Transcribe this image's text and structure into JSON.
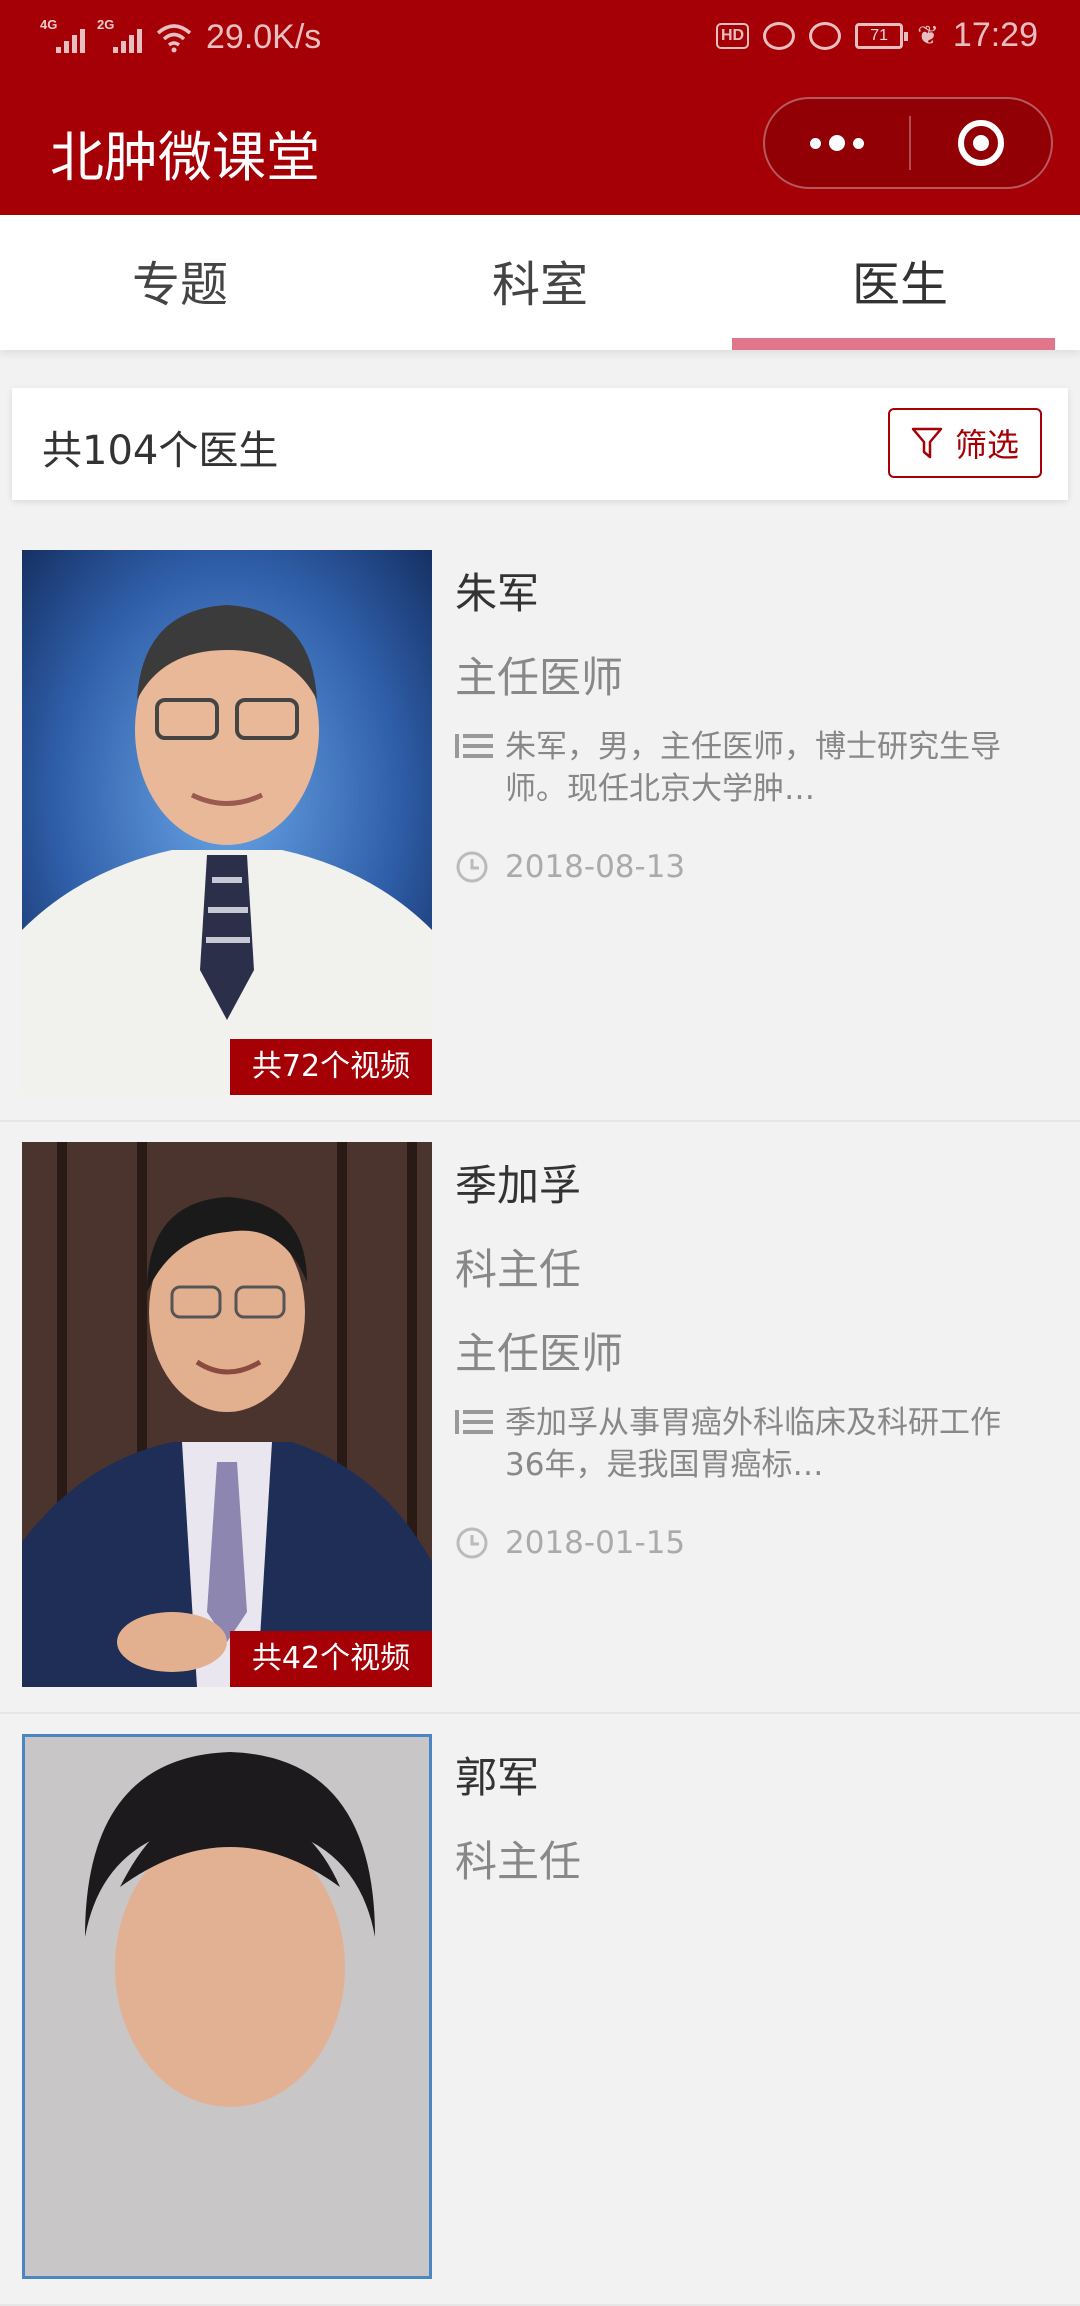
{
  "status_bar": {
    "network_1": "4G",
    "network_2": "2G",
    "speed": "29.0K/s",
    "hd": "HD",
    "battery": "71",
    "time": "17:29"
  },
  "nav": {
    "title": "北肿微课堂"
  },
  "tabs": [
    {
      "label": "专题",
      "active": false
    },
    {
      "label": "科室",
      "active": false
    },
    {
      "label": "医生",
      "active": true
    }
  ],
  "colors": {
    "brand": "#a50006",
    "tab_indicator": "#e0758c"
  },
  "summary": {
    "count_text": "共104个医生",
    "filter_label": "筛选"
  },
  "doctors": [
    {
      "name": "朱军",
      "roles": [
        "主任医师"
      ],
      "description": "朱军，男，主任医师，博士研究生导师。现任北京大学肿…",
      "date": "2018-08-13",
      "video_count": "共72个视频"
    },
    {
      "name": "季加孚",
      "roles": [
        "科主任",
        "主任医师"
      ],
      "description": "季加孚从事胃癌外科临床及科研工作36年，是我国胃癌标…",
      "date": "2018-01-15",
      "video_count": "共42个视频"
    },
    {
      "name": "郭军",
      "roles": [
        "科主任"
      ]
    }
  ]
}
